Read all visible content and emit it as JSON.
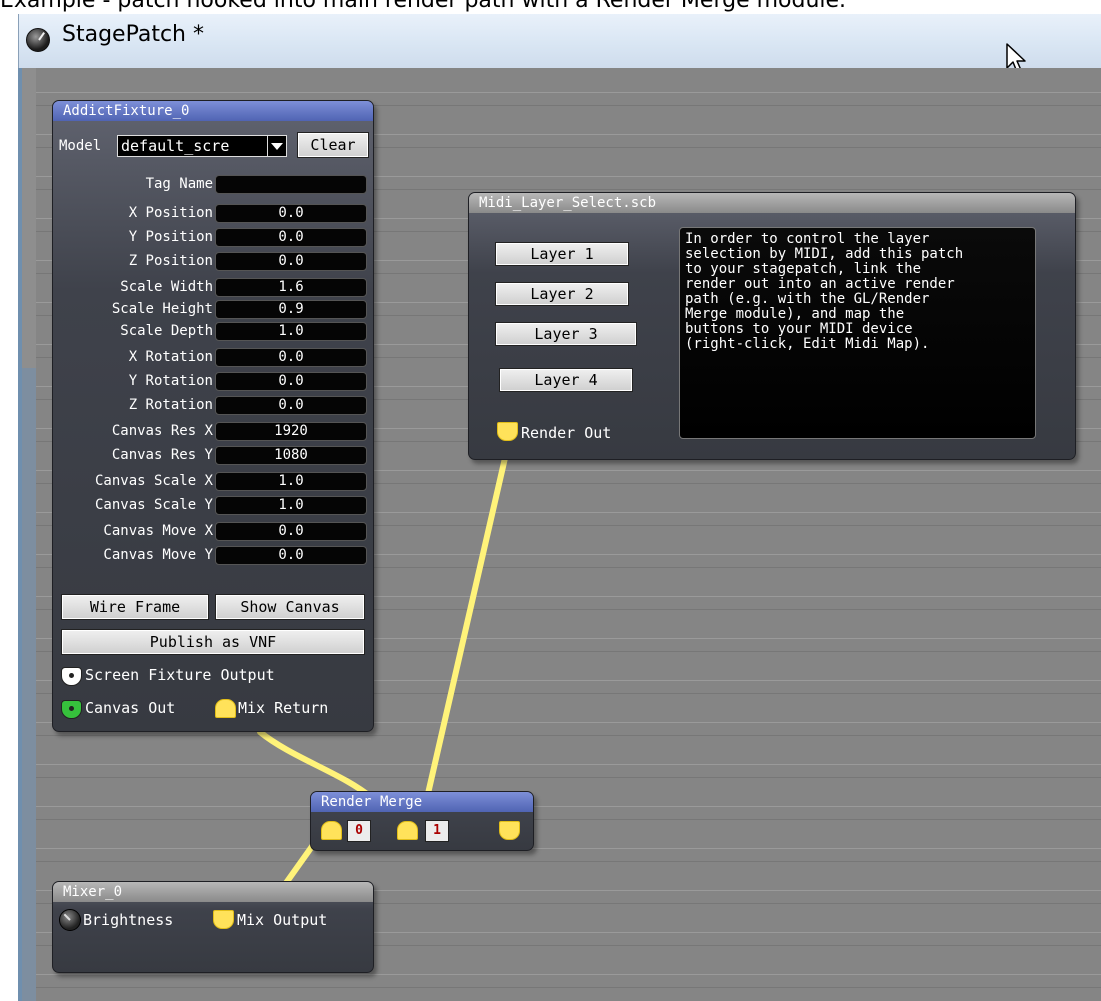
{
  "caption": "Example - patch hooked into main render path with a Render Merge module.",
  "window": {
    "title": "StagePatch *"
  },
  "colors": {
    "wire": "#fff37a",
    "title_blue": "#5a6dbd",
    "port_yellow": "#ffe25a",
    "port_green": "#36c13c"
  },
  "fixture": {
    "title": "AddictFixture_0",
    "model_label": "Model",
    "model_value": "default_scre",
    "clear_label": "Clear",
    "tag_name_label": "Tag Name",
    "tag_name_value": "",
    "fields": [
      {
        "label": "X Position",
        "value": "0.0"
      },
      {
        "label": "Y Position",
        "value": "0.0"
      },
      {
        "label": "Z Position",
        "value": "0.0"
      },
      {
        "label": "Scale Width",
        "value": "1.6"
      },
      {
        "label": "Scale Height",
        "value": "0.9"
      },
      {
        "label": "Scale Depth",
        "value": "1.0"
      },
      {
        "label": "X Rotation",
        "value": "0.0"
      },
      {
        "label": "Y Rotation",
        "value": "0.0"
      },
      {
        "label": "Z Rotation",
        "value": "0.0"
      },
      {
        "label": "Canvas Res X",
        "value": "1920"
      },
      {
        "label": "Canvas Res Y",
        "value": "1080"
      },
      {
        "label": "Canvas Scale X",
        "value": "1.0"
      },
      {
        "label": "Canvas Scale Y",
        "value": "1.0"
      },
      {
        "label": "Canvas Move X",
        "value": "0.0"
      },
      {
        "label": "Canvas Move Y",
        "value": "0.0"
      }
    ],
    "wire_frame_label": "Wire Frame",
    "show_canvas_label": "Show Canvas",
    "publish_label": "Publish as VNF",
    "screen_output_label": "Screen Fixture Output",
    "canvas_out_label": "Canvas Out",
    "mix_return_label": "Mix Return"
  },
  "midi": {
    "title": "Midi_Layer_Select.scb",
    "buttons": [
      "Layer 1",
      "Layer 2",
      "Layer 3",
      "Layer 4"
    ],
    "description": "In order to control the layer\nselection by MIDI, add this patch\nto your stagepatch, link the\nrender out into an active render\npath (e.g. with the GL/Render\nMerge module), and map the\nbuttons to your MIDI device\n(right-click, Edit Midi Map).",
    "render_out_label": "Render Out"
  },
  "merge": {
    "title": "Render Merge",
    "inputs": [
      "0",
      "1"
    ]
  },
  "mixer": {
    "title": "Mixer_0",
    "brightness_label": "Brightness",
    "output_label": "Mix Output"
  }
}
